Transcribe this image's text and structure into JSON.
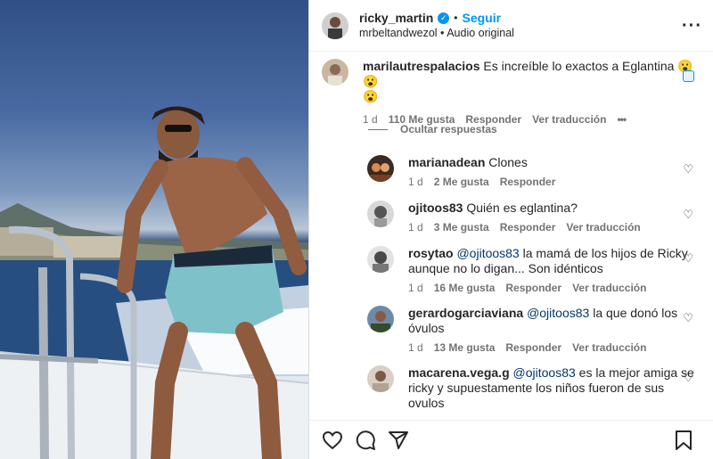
{
  "post": {
    "username": "ricky_martin",
    "follow_label": "Seguir",
    "subtitle_user": "mrbeltandwezol",
    "subtitle_audio": "Audio original",
    "dot": "•"
  },
  "top_comment": {
    "username": "marilautrespalacios",
    "text_line1": "Es increíble lo exactos a Eglantina 😮😮",
    "text_line2": "😮",
    "time": "1 d",
    "likes": "110 Me gusta",
    "reply_label": "Responder",
    "translate_label": "Ver traducción",
    "more": "•••"
  },
  "hide_replies_label": "Ocultar respuestas",
  "replies": [
    {
      "username": "marianadean",
      "text": "Clones",
      "time": "1 d",
      "likes": "2 Me gusta",
      "reply_label": "Responder",
      "translate_label": ""
    },
    {
      "username": "ojitoos83",
      "text": "Quién es eglantina?",
      "time": "1 d",
      "likes": "3 Me gusta",
      "reply_label": "Responder",
      "translate_label": "Ver traducción"
    },
    {
      "username": "rosytao",
      "mention": "@ojitoos83",
      "text_line1": "la mamá de los hijos de Ricky",
      "text_line2": "aunque no lo digan... Son idénticos",
      "time": "1 d",
      "likes": "16 Me gusta",
      "reply_label": "Responder",
      "translate_label": "Ver traducción"
    },
    {
      "username": "gerardogarciaviana",
      "mention": "@ojitoos83",
      "text_line1": "la que donó los",
      "text_line2": "óvulos",
      "time": "1 d",
      "likes": "13 Me gusta",
      "reply_label": "Responder",
      "translate_label": "Ver traducción"
    },
    {
      "username": "macarena.vega.g",
      "mention": "@ojitoos83",
      "text_line1": "es la mejor amiga se",
      "text_line2": "ricky y supuestamente los niños fueron de sus",
      "text_line3": "ovulos"
    }
  ],
  "icons": {
    "verified": "verified-badge-icon",
    "more": "more-options-icon",
    "like": "heart-icon",
    "comment": "comment-icon",
    "share": "share-icon",
    "save": "bookmark-icon"
  },
  "colors": {
    "accent": "#0095f6",
    "text": "#262626",
    "muted": "#737373"
  }
}
